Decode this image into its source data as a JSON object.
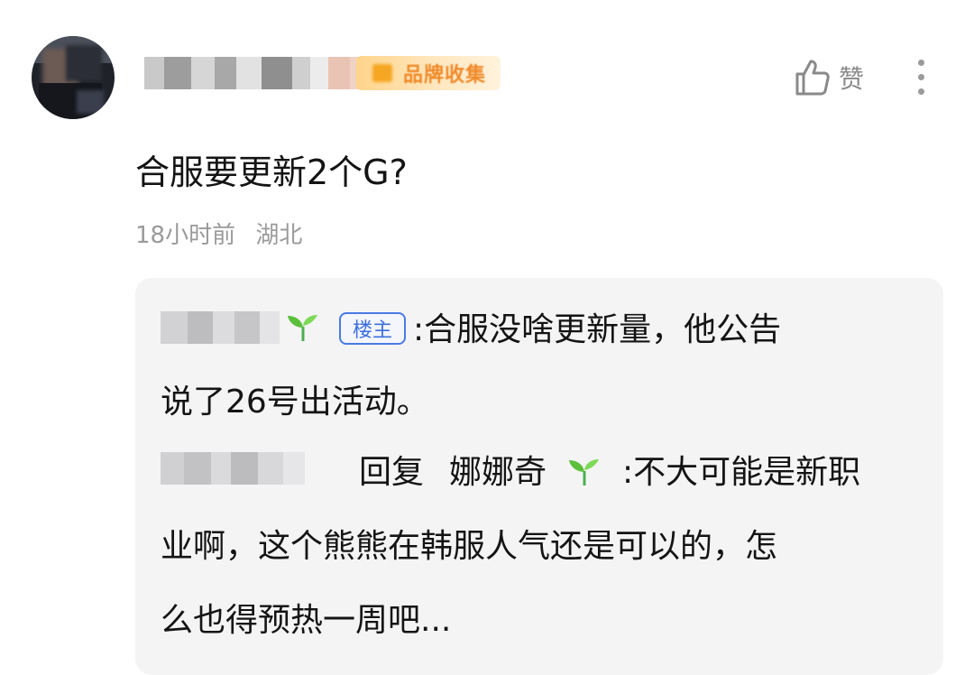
{
  "post": {
    "title": "合服要更新2个G?",
    "time": "18小时前",
    "location": "湖北"
  },
  "header": {
    "badge_text": "品牌收集",
    "like_label": "赞",
    "like_icon": "thumbs-up-icon",
    "more_icon": "more-vertical-icon"
  },
  "replies": {
    "first": {
      "owner_tag": "楼主",
      "line1": ":合服没啥更新量，他公告",
      "line2": "说了26号出活动。"
    },
    "second": {
      "reply_to_label": "回复",
      "reply_to_name": "娜娜奇",
      "line1_rest": ":不大可能是新职",
      "line2": "业啊，这个熊熊在韩服人气还是可以的，怎",
      "line3": "么也得预热一周吧..."
    }
  },
  "colors": {
    "owner_tag": "#3d6fdc",
    "panel_bg": "#f4f4f5",
    "meta_text": "#9a9a9a"
  }
}
